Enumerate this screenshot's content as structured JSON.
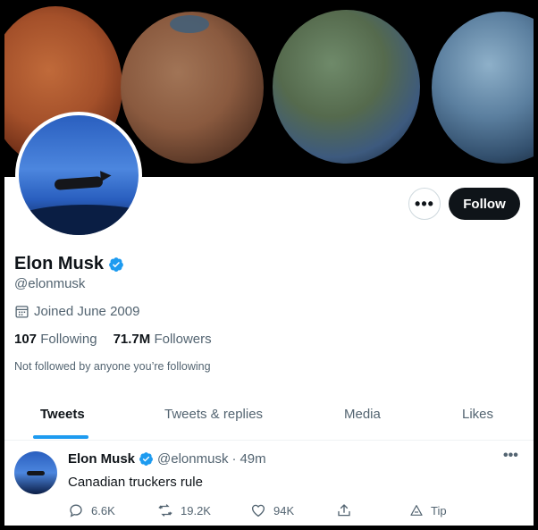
{
  "profile": {
    "name": "Elon Musk",
    "handle": "@elonmusk",
    "joined": "Joined June 2009",
    "following_count": "107",
    "following_label": "Following",
    "followers_count": "71.7M",
    "followers_label": "Followers",
    "not_followed_text": "Not followed by anyone you’re following"
  },
  "actions": {
    "more_label": "•••",
    "follow_label": "Follow"
  },
  "tabs": [
    {
      "label": "Tweets",
      "active": true
    },
    {
      "label": "Tweets & replies",
      "active": false
    },
    {
      "label": "Media",
      "active": false
    },
    {
      "label": "Likes",
      "active": false
    }
  ],
  "tweet": {
    "name": "Elon Musk",
    "handle": "@elonmusk",
    "separator": "·",
    "time": "49m",
    "text": "Canadian truckers rule",
    "more_label": "•••",
    "replies": "6.6K",
    "retweets": "19.2K",
    "likes": "94K",
    "tip_label": "Tip"
  },
  "colors": {
    "accent": "#1d9bf0",
    "text": "#0f1419",
    "muted": "#536471",
    "follow_bg": "#0f1419"
  }
}
